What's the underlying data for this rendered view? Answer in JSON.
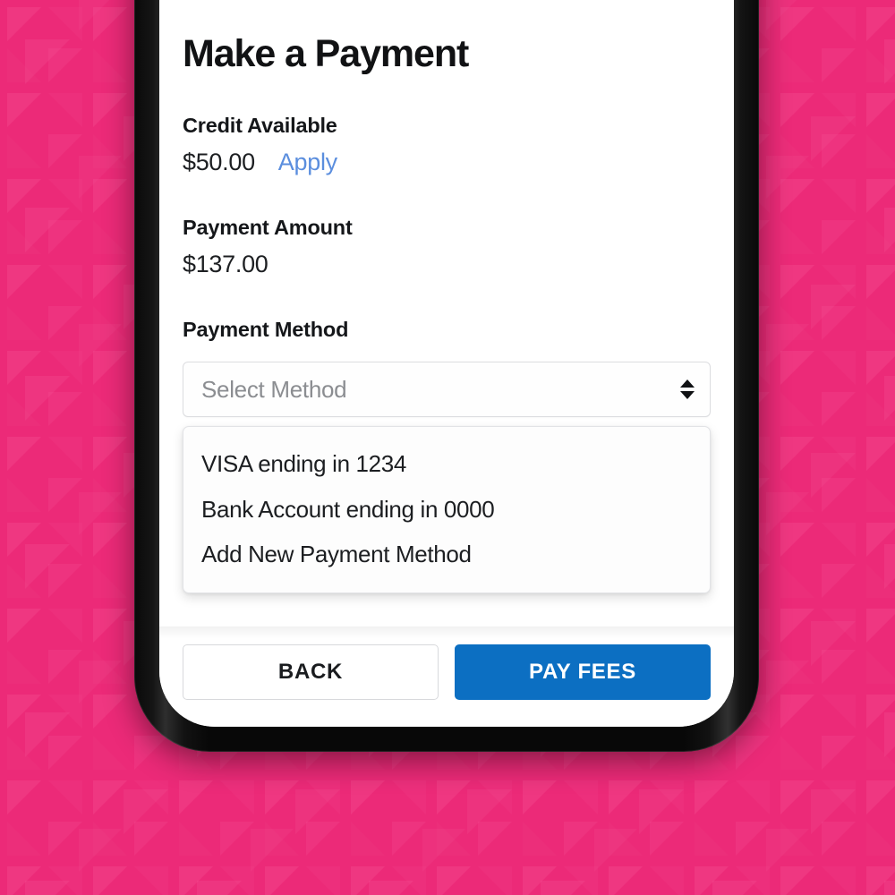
{
  "background": {
    "color": "#ec2a78",
    "pattern_color": "#f04a8c",
    "pattern_name": "triangle-tile-pattern"
  },
  "device": {
    "name": "smartphone-mockup",
    "bezel_color": "#0a0a0a",
    "screen_color": "#ffffff"
  },
  "screen": {
    "page_title": "Make a Payment",
    "sections": {
      "credit": {
        "label": "Credit Available",
        "amount": "$50.00",
        "apply_label": "Apply",
        "apply_color": "#5b8ede"
      },
      "payment_amount": {
        "label": "Payment Amount",
        "amount": "$137.00"
      },
      "payment_method": {
        "label": "Payment Method",
        "select_placeholder": "Select Method",
        "select_value": "",
        "stepper_icon": "updown-stepper-icon",
        "options": [
          "VISA ending in 1234",
          "Bank Account ending in 0000",
          "Add New Payment Method"
        ]
      }
    },
    "footer": {
      "back_label": "BACK",
      "pay_label": "PAY FEES",
      "pay_color": "#0c6fc2"
    }
  }
}
